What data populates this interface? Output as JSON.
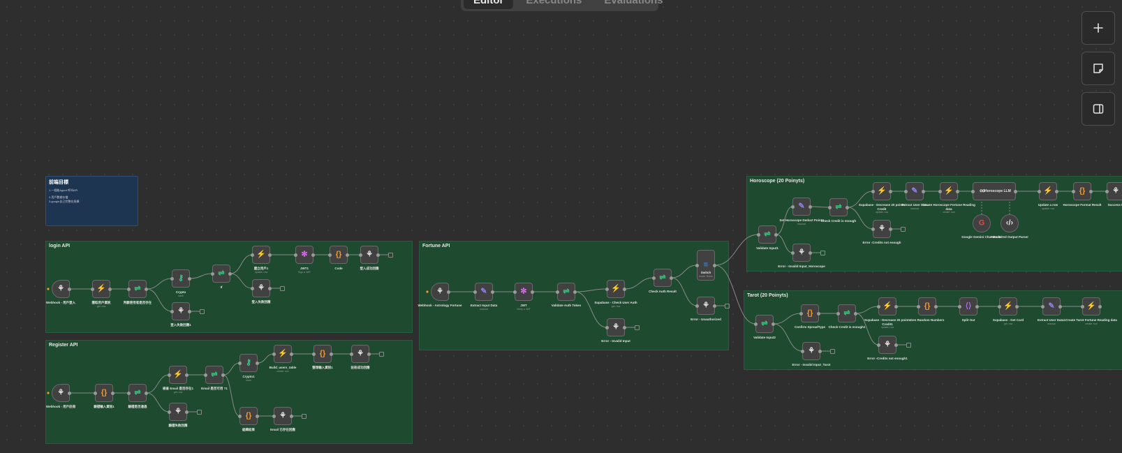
{
  "editor_tabs": [
    "Editor",
    "Executions",
    "Evaluations"
  ],
  "toolbar": {
    "zoom_in_icon": "plus-icon",
    "sticky_icon": "sticky-note-icon",
    "panel_icon": "side-panel-icon"
  },
  "colors": {
    "canvas": "#2e2e2e",
    "group_bg": "#1e4a2f",
    "sticky_bg": "#1d3550",
    "accent_green": "#27a567",
    "accent_orange": "#f29a2c",
    "accent_purple": "#8d7fe6"
  },
  "sticky": {
    "title": "前端目標",
    "lines": [
      "1.一個能Agent 呼叫API",
      "2.用戶數據存檔",
      "3.google自己完整化採擷"
    ]
  },
  "groups": [
    {
      "name": "login API",
      "title": "login API"
    },
    {
      "name": "register-api",
      "title": "Register API"
    },
    {
      "name": "fortune-api",
      "title": "Fortune API"
    },
    {
      "name": "horoscope",
      "title": "Horoscope (20 Poinyts)"
    },
    {
      "name": "tarot",
      "title": "Tarot (20 Poinyts)"
    }
  ],
  "nodes": [
    {
      "label": "Webhook - 用戶登入",
      "sub": "",
      "icon": "webhook-icon"
    },
    {
      "label": "獲取用戶資訊",
      "sub": "get: row",
      "icon": "supabase-icon"
    },
    {
      "label": "判斷使用者是否存在",
      "sub": "",
      "icon": "if-icon"
    },
    {
      "label": "Crypto",
      "sub": "hash",
      "icon": "key-icon"
    },
    {
      "label": "登入失敗回應1",
      "sub": "",
      "icon": "webhook-icon"
    },
    {
      "label": "If",
      "sub": "",
      "icon": "if-icon"
    },
    {
      "label": "建立用戶1",
      "sub": "update: row",
      "icon": "supabase-icon"
    },
    {
      "label": "登入失敗回應",
      "sub": "",
      "icon": "webhook-icon"
    },
    {
      "label": "JWT1",
      "sub": "Sign a JWT",
      "icon": "jwt-icon"
    },
    {
      "label": "Code",
      "sub": "",
      "icon": "code-icon"
    },
    {
      "label": "登入成功回應",
      "sub": "",
      "icon": "webhook-icon"
    },
    {
      "label": "Webhook - 用戶註冊",
      "sub": "",
      "icon": "webhook-icon"
    },
    {
      "label": "驗證輸入資訊1",
      "sub": "",
      "icon": "code-icon"
    },
    {
      "label": "驗證是否通過",
      "sub": "",
      "icon": "if-icon"
    },
    {
      "label": "檢查 Email 是否存在1",
      "sub": "get: row",
      "icon": "supabase-icon"
    },
    {
      "label": "驗證失敗回應",
      "sub": "",
      "icon": "webhook-icon"
    },
    {
      "label": "Email 是否可用 ?1",
      "sub": "",
      "icon": "if-icon"
    },
    {
      "label": "Crypto1",
      "sub": "hash",
      "icon": "key-icon"
    },
    {
      "label": "組織結果",
      "sub": "",
      "icon": "code-icon"
    },
    {
      "label": "Email 已存在回應",
      "sub": "",
      "icon": "webhook-icon"
    },
    {
      "label": "Build_users_table",
      "sub": "create: row",
      "icon": "supabase-icon"
    },
    {
      "label": "整理輸入資訊1",
      "sub": "",
      "icon": "code-icon"
    },
    {
      "label": "註冊成功回應",
      "sub": "",
      "icon": "webhook-icon"
    },
    {
      "label": "Webhook - Astrology Fortune",
      "sub": "",
      "icon": "webhook-icon"
    },
    {
      "label": "Extract Input Data",
      "sub": "manual",
      "icon": "edit-icon"
    },
    {
      "label": "JWT",
      "sub": "Verify a JWT",
      "icon": "jwt-icon"
    },
    {
      "label": "Validate Auth Token",
      "sub": "",
      "icon": "if-icon"
    },
    {
      "label": "Error - Invalid Input",
      "sub": "",
      "icon": "webhook-icon"
    },
    {
      "label": "Supabase - Check User Auth",
      "sub": "get: row",
      "icon": "supabase-icon"
    },
    {
      "label": "Check Auth Result",
      "sub": "",
      "icon": "if-icon"
    },
    {
      "label": "Switch",
      "sub": "mode: Rules",
      "icon": "switch-icon"
    },
    {
      "label": "Error - Unauthorized",
      "sub": "",
      "icon": "webhook-icon"
    },
    {
      "label": "Validate Input1",
      "sub": "",
      "icon": "if-icon"
    },
    {
      "label": "Set Horoscope Deduct Points",
      "sub": "manual",
      "icon": "edit-icon"
    },
    {
      "label": "Error - Invalid Input_Horoscope",
      "sub": "",
      "icon": "webhook-icon"
    },
    {
      "label": "Check Credit is enough",
      "sub": "",
      "icon": "if-icon"
    },
    {
      "label": "Supabase - Decrease 20 points Credit",
      "sub": "update: row",
      "icon": "supabase-icon"
    },
    {
      "label": "Error -Credits not enough",
      "sub": "",
      "icon": "webhook-icon"
    },
    {
      "label": "Extract User Data",
      "sub": "manual",
      "icon": "edit-icon"
    },
    {
      "label": "Create Horoscope Fortune Reading data",
      "sub": "create: row",
      "icon": "supabase-icon"
    },
    {
      "label": "Horoscope LLM",
      "sub": "",
      "icon": "chain-icon"
    },
    {
      "label": "Google Gemini Chat Model",
      "sub": "",
      "icon": "google-icon"
    },
    {
      "label": "Structured Output Parser",
      "sub": "",
      "icon": "parser-icon"
    },
    {
      "label": "Update a row",
      "sub": "update: row",
      "icon": "supabase-icon"
    },
    {
      "label": "Horoscope Format Result",
      "sub": "",
      "icon": "code-icon"
    },
    {
      "label": "Success R",
      "sub": "",
      "icon": "webhook-icon"
    },
    {
      "label": "Validate Input2",
      "sub": "",
      "icon": "if-icon"
    },
    {
      "label": "Confirm SpreadType",
      "sub": "",
      "icon": "code-icon"
    },
    {
      "label": "Error - Invalid Input_Tarot",
      "sub": "",
      "icon": "webhook-icon"
    },
    {
      "label": "Check Credit is enough1",
      "sub": "",
      "icon": "if-icon"
    },
    {
      "label": "Supabase - Decrease 20 points Credit1",
      "sub": "update: row",
      "icon": "supabase-icon"
    },
    {
      "label": "Error -Credits not enough1",
      "sub": "",
      "icon": "webhook-icon"
    },
    {
      "label": "Gen Random Numbers",
      "sub": "",
      "icon": "code-icon"
    },
    {
      "label": "Split Out",
      "sub": "",
      "icon": "split-icon"
    },
    {
      "label": "Supabase - Get Card",
      "sub": "get: row",
      "icon": "supabase-icon"
    },
    {
      "label": "Extract User Data1",
      "sub": "manual",
      "icon": "edit-icon"
    },
    {
      "label": "Create Tarot Fortune Reading data",
      "sub": "create: row",
      "icon": "supabase-icon"
    }
  ]
}
